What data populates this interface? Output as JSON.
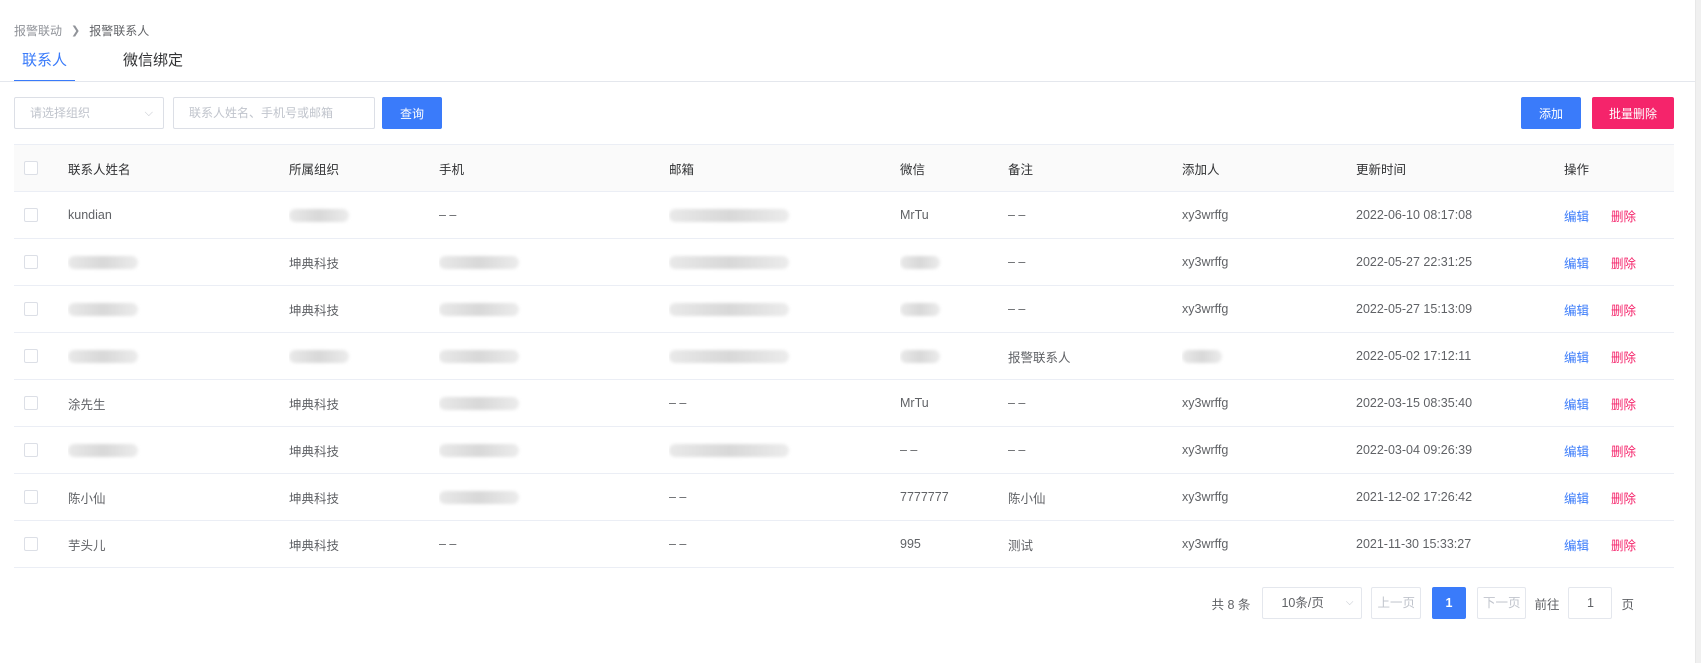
{
  "breadcrumb": {
    "parent": "报警联动",
    "current": "报警联系人"
  },
  "tabs": [
    {
      "label": "联系人",
      "active": true
    },
    {
      "label": "微信绑定",
      "active": false
    }
  ],
  "toolbar": {
    "org_placeholder": "请选择组织",
    "search_placeholder": "联系人姓名、手机号或邮箱",
    "query_label": "查询",
    "add_label": "添加",
    "batch_delete_label": "批量删除"
  },
  "table": {
    "headers": {
      "name": "联系人姓名",
      "org": "所属组织",
      "phone": "手机",
      "email": "邮箱",
      "wechat": "微信",
      "remark": "备注",
      "adder": "添加人",
      "updated": "更新时间",
      "ops": "操作"
    },
    "rows": [
      {
        "name": "kundian",
        "org": "",
        "phone": "– –",
        "email": "",
        "wechat": "MrTu",
        "remark": "– –",
        "adder": "xy3wrffg",
        "updated": "2022-06-10 08:17:08"
      },
      {
        "name": "",
        "org": "坤典科技",
        "phone": "",
        "email": "",
        "wechat": "",
        "remark": "– –",
        "adder": "xy3wrffg",
        "updated": "2022-05-27 22:31:25"
      },
      {
        "name": "",
        "org": "坤典科技",
        "phone": "",
        "email": "",
        "wechat": "",
        "remark": "– –",
        "adder": "xy3wrffg",
        "updated": "2022-05-27 15:13:09"
      },
      {
        "name": "",
        "org": "",
        "phone": "",
        "email": "",
        "wechat": "",
        "remark": "报警联系人",
        "adder": "",
        "updated": "2022-05-02 17:12:11"
      },
      {
        "name": "涂先生",
        "org": "坤典科技",
        "phone": "",
        "email": "– –",
        "wechat": "MrTu",
        "remark": "– –",
        "adder": "xy3wrffg",
        "updated": "2022-03-15 08:35:40"
      },
      {
        "name": "",
        "org": "坤典科技",
        "phone": "",
        "email": "",
        "wechat": "– –",
        "remark": "– –",
        "adder": "xy3wrffg",
        "updated": "2022-03-04 09:26:39"
      },
      {
        "name": "陈小仙",
        "org": "坤典科技",
        "phone": "",
        "email": "– –",
        "wechat": "7777777",
        "remark": "陈小仙",
        "adder": "xy3wrffg",
        "updated": "2021-12-02 17:26:42"
      },
      {
        "name": "芋头儿",
        "org": "坤典科技",
        "phone": "– –",
        "email": "– –",
        "wechat": "995",
        "remark": "测试",
        "adder": "xy3wrffg",
        "updated": "2021-11-30 15:33:27"
      }
    ],
    "edit_label": "编辑",
    "delete_label": "删除"
  },
  "pagination": {
    "total_text": "共 8 条",
    "page_size": "10条/页",
    "prev_label": "上一页",
    "current_page": "1",
    "next_label": "下一页",
    "goto_label": "前往",
    "goto_value": "1",
    "page_unit": "页"
  },
  "colors": {
    "primary": "#3a7bfa",
    "danger": "#f5246b"
  }
}
